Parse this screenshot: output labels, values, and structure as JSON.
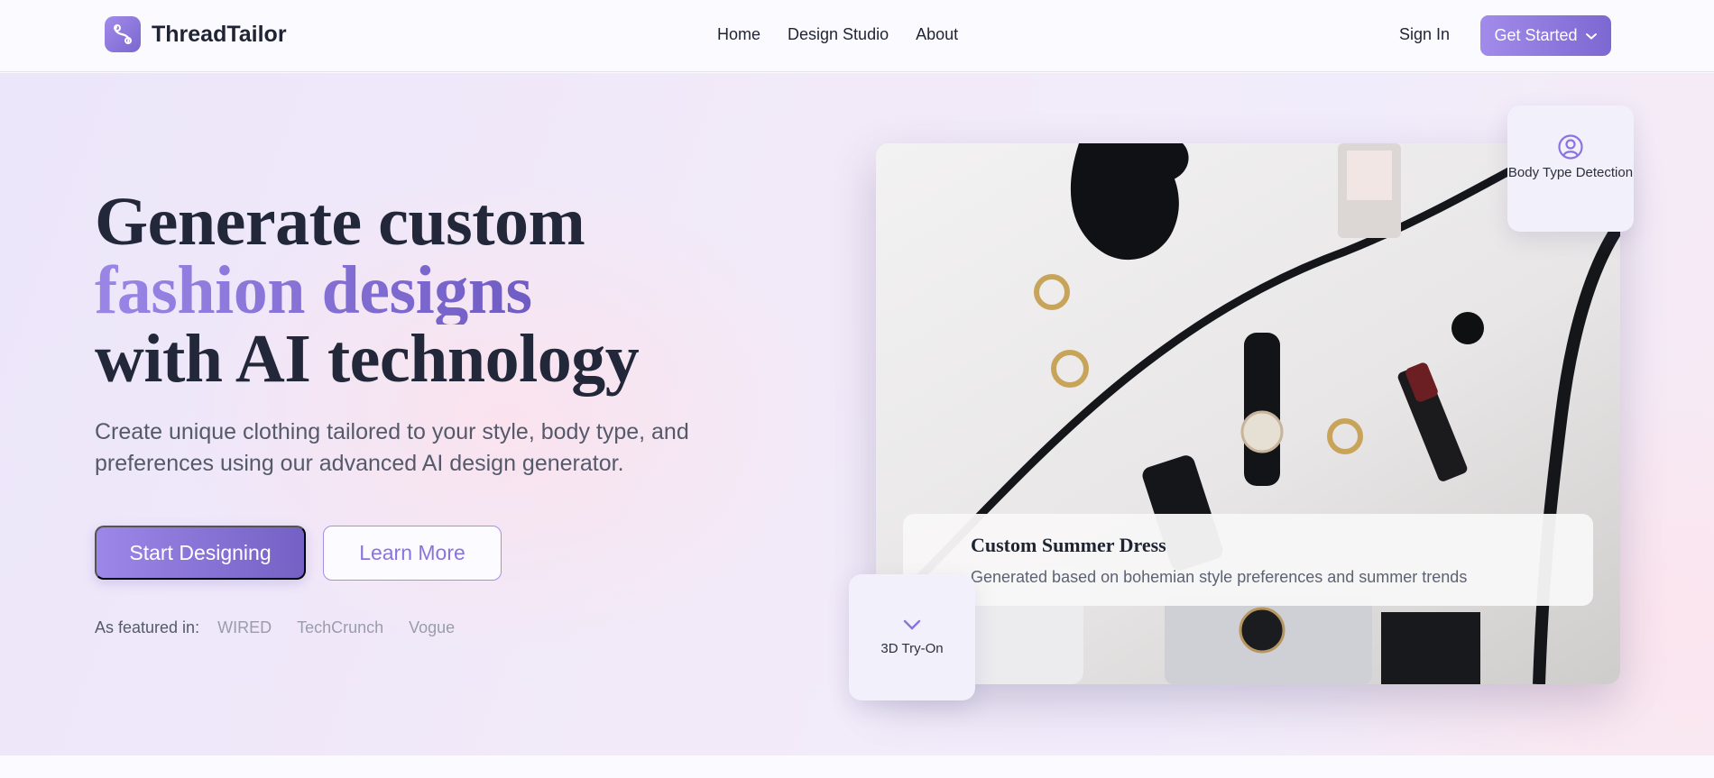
{
  "header": {
    "brand": "ThreadTailor",
    "nav": [
      {
        "label": "Home"
      },
      {
        "label": "Design Studio"
      },
      {
        "label": "About"
      }
    ],
    "sign_in": "Sign In",
    "get_started": "Get Started"
  },
  "hero": {
    "headline_line1": "Generate custom",
    "headline_line2": "fashion designs",
    "headline_line3": "with AI technology",
    "subtext": "Create unique clothing tailored to your style, body type, and preferences using our advanced AI design generator.",
    "primary_cta": "Start Designing",
    "secondary_cta": "Learn More",
    "featured_label": "As featured in:",
    "featured_brands": [
      "WIRED",
      "TechCrunch",
      "Vogue"
    ]
  },
  "showcase": {
    "caption_title": "Custom Summer Dress",
    "caption_subtitle": "Generated based on bohemian style preferences and summer trends",
    "badge_body_type": "Body Type Detection",
    "badge_3d": "3D Try-On"
  },
  "colors": {
    "accent": "#8b74de",
    "accent_dark": "#7461c4",
    "text_dark": "#222839"
  },
  "icons": {
    "logo": "thread-needle-icon",
    "get_started": "chevron-down-icon",
    "body_type": "user-circle-icon",
    "try_on": "chevron-down-icon"
  }
}
